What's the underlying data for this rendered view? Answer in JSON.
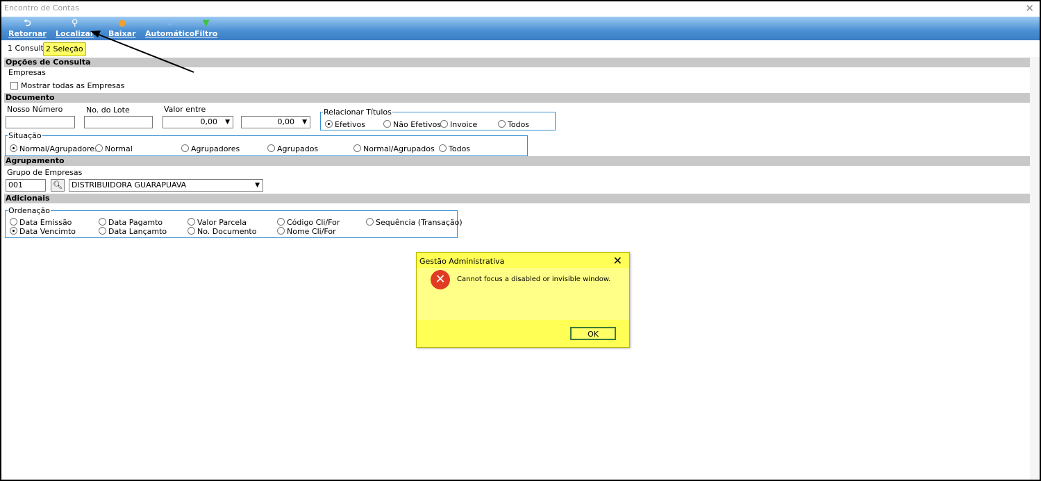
{
  "window": {
    "title": "Encontro de Contas"
  },
  "toolbar": {
    "retornar": "Retornar",
    "localizar": "Localizar",
    "baixar": "Baixar",
    "automatico": "Automático",
    "filtro": "Filtro"
  },
  "tabs": {
    "consulta": "1 Consulta",
    "selecao": "2 Seleção"
  },
  "opcoes": {
    "header": "Opções de Consulta",
    "empresas_label": "Empresas",
    "mostrar_todas": "Mostrar todas as Empresas"
  },
  "documento": {
    "header": "Documento",
    "nosso_numero": "Nosso Número",
    "no_lote": "No. do Lote",
    "valor_entre": "Valor entre",
    "valor_de": "0,00",
    "valor_ate": "0,00",
    "relacionar_titulos": "Relacionar Títulos",
    "rel_options": [
      "Efetivos",
      "Não Efetivos",
      "Invoice",
      "Todos"
    ]
  },
  "situacao": {
    "label": "Situação",
    "options": [
      "Normal/Agrupadores",
      "Normal",
      "Agrupadores",
      "Agrupados",
      "Normal/Agrupados",
      "Todos"
    ]
  },
  "agrupamento": {
    "header": "Agrupamento",
    "grupo_label": "Grupo de Empresas",
    "grupo_code": "001",
    "grupo_name": "DISTRIBUIDORA GUARAPUAVA"
  },
  "adicionais": {
    "header": "Adicionais",
    "ordenacao": "Ordenação",
    "row1": [
      "Data Emissão",
      "Data Pagamto",
      "Valor Parcela",
      "Código Cli/For",
      "Sequência (Transação)"
    ],
    "row2": [
      "Data Vencimto",
      "Data Lançamto",
      "No. Documento",
      "Nome Cli/For"
    ]
  },
  "dialog": {
    "title": "Gestão Administrativa",
    "message": "Cannot focus a disabled or invisible window.",
    "ok": "OK"
  },
  "colors": {
    "toolbar": "#4b8fd3",
    "dialog": "#ffff55",
    "group_border": "#3a8fd0"
  }
}
